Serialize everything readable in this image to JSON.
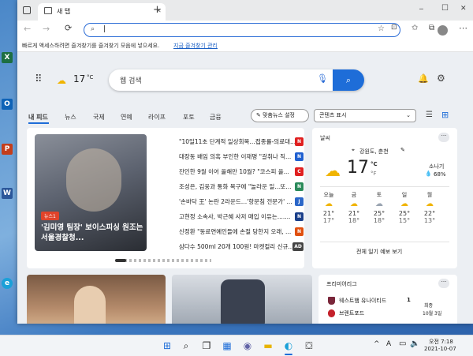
{
  "desktop": {
    "icons": [
      {
        "label": "Microsoft Excel",
        "short": "X",
        "color": "#1d6f42"
      },
      {
        "label": "Outlook",
        "short": "O",
        "color": "#0f63b7"
      },
      {
        "label": "PowerPoint",
        "short": "P",
        "color": "#c43e1c"
      },
      {
        "label": "Word",
        "short": "W",
        "color": "#2b579a"
      },
      {
        "label": "Edge",
        "short": "e",
        "color": "#1aa0d8"
      }
    ]
  },
  "browser": {
    "tab_title": "새 탭",
    "tab_close": "✕",
    "new_tab": "+",
    "window_controls": {
      "minimize": "─",
      "maximize": "☐",
      "close": "✕"
    },
    "address": {
      "value": "",
      "cursor": "|"
    },
    "favbar": {
      "message": "빠르게 액세스하려면 즐겨찾기를 즐겨찾기 모음에 넣으세요.",
      "link": "지금 즐겨찾기 관리"
    }
  },
  "newtab": {
    "temperature": "17",
    "temp_unit": "°C",
    "search_placeholder": "웹 검색",
    "nav_tabs": [
      "내 피드",
      "뉴스",
      "국제",
      "연예",
      "라이프",
      "포토",
      "금융"
    ],
    "personalize_button": "맞춤뉴스 설정",
    "content_display": "콘텐츠 표시",
    "hero": {
      "tag": "뉴스1",
      "headline": "'김미영 팀장' 보이스피싱 원조는 서울경찰청..."
    },
    "headlines": [
      {
        "text": "\"10일11초 단계적 일상회복…접종률-의료대...",
        "src": "N",
        "color": "#e02020"
      },
      {
        "text": "대장동 배임 의혹 부인한 이재명 \"갈취나 직...",
        "src": "N",
        "color": "#2060d0"
      },
      {
        "text": "잔인한 9월 이어 올해만 10월? \"코스피 올...",
        "src": "C",
        "color": "#e02020"
      },
      {
        "text": "조성은, 김웅과 통화 복구에 \"놀라운 일...또...",
        "src": "N",
        "color": "#2a8a5a"
      },
      {
        "text": "'손바닥 王' 논란 2라운드…'항문침 전문가' ...",
        "src": "J",
        "color": "#2a66c8"
      },
      {
        "text": "고현정 소속사, 박근혜 사저 매입 이유는.......",
        "src": "N",
        "color": "#1a3f8a"
      },
      {
        "text": "신정환 \"동료연예인들에 손절 당한지 오래, ...",
        "src": "N",
        "color": "#e05010"
      },
      {
        "text": "삼다수 500ml 20개 100원! 마켓컬리 신규...",
        "src": "AD",
        "color": "#444"
      }
    ],
    "weather": {
      "title": "날씨",
      "location": "강원도, 춘천",
      "temp": "17",
      "unit_c": "°C",
      "unit_f": "°F",
      "condition": "소나기",
      "humidity": "68%",
      "days": [
        {
          "day": "오늘",
          "hi": "21°",
          "lo": "17°"
        },
        {
          "day": "금",
          "hi": "21°",
          "lo": "18°"
        },
        {
          "day": "토",
          "hi": "25°",
          "lo": "18°"
        },
        {
          "day": "일",
          "hi": "25°",
          "lo": "15°"
        },
        {
          "day": "월",
          "hi": "22°",
          "lo": "13°"
        }
      ],
      "forecast_link": "전체 일기 예보 보기"
    },
    "sports": {
      "title": "프리미어리그",
      "team1": "웨스트햄 유나이티드",
      "score1": "1",
      "team2": "브렌트포드",
      "status": "최종",
      "date": "10월 3일"
    },
    "more": "···"
  },
  "taskbar": {
    "time": "오전 7:18",
    "date": "2021-10-07",
    "tray_chevron": "^",
    "ime": "A"
  }
}
